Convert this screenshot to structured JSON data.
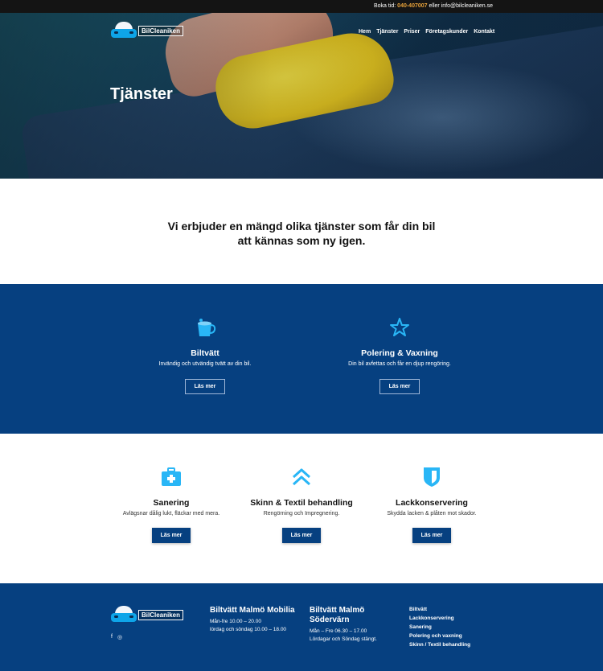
{
  "topbar": {
    "prefix": "Boka tid:",
    "phone": "040-407007",
    "middle": "eller",
    "email": "info@bilcleaniken.se"
  },
  "logo": {
    "name": "BilCleaniken"
  },
  "nav": {
    "items": [
      "Hem",
      "Tjänster",
      "Priser",
      "Företagskunder",
      "Kontakt"
    ]
  },
  "hero": {
    "title": "Tjänster"
  },
  "intro": {
    "text": "Vi erbjuder en mängd olika tjänster som får din bil att kännas som ny igen."
  },
  "services": [
    {
      "title": "Biltvätt",
      "description": "Invändig och utvändig tvätt av din bil.",
      "button": "Läs mer",
      "icon": "bucket-icon"
    },
    {
      "title": "Polering & Vaxning",
      "description": "Din bil avfettas och får en djup rengöring.",
      "button": "Läs mer",
      "icon": "star-icon"
    },
    {
      "title": "Sanering",
      "description": "Avlägsnar dålig lukt, fläckar med mera.",
      "button": "Läs mer",
      "icon": "first-aid-kit-icon"
    },
    {
      "title": "Skinn & Textil behandling",
      "description": "Rengörning och Impregnering.",
      "button": "Läs mer",
      "icon": "double-chevron-up-icon"
    },
    {
      "title": "Lackkonservering",
      "description": "Skydda lacken & plåten mot skador.",
      "button": "Läs mer",
      "icon": "shield-icon"
    }
  ],
  "colors": {
    "primary": "#064080",
    "accent_icon": "#29b6f6",
    "phone": "#e8a23a"
  },
  "footer": {
    "social": [
      "f",
      "◎"
    ],
    "locations": [
      {
        "title": "Biltvätt Malmö Mobilia",
        "hours": [
          "Mån-fre 10.00 – 20.00",
          "lördag och söndag 10.00 – 18.00"
        ]
      },
      {
        "title": "Biltvätt Malmö Södervärn",
        "hours": [
          "Mån – Fre 06.30 – 17.00",
          "Lördagar och Söndag stängt."
        ]
      }
    ],
    "links": [
      "Biltvätt",
      "Lackkonservering",
      "Sanering",
      "Polering och vaxning",
      "Skinn / Textil behandling"
    ]
  }
}
